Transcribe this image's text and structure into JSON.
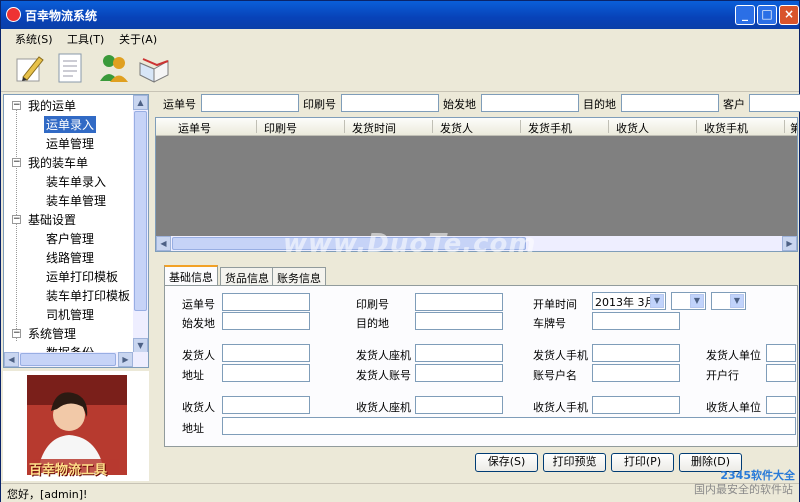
{
  "window": {
    "title": "百幸物流系统",
    "buttons": {
      "minimize": "_",
      "maximize": "□",
      "close": "×"
    }
  },
  "menubar": {
    "items": [
      "系统(S)",
      "工具(T)",
      "关于(A)"
    ]
  },
  "toolbar": {
    "tools": [
      "pencil-edit-icon",
      "document-icon",
      "users-icon",
      "book-icon"
    ]
  },
  "sidebar": {
    "tree": [
      {
        "label": "我的运单",
        "expander": "−"
      },
      {
        "label": "运单录入"
      },
      {
        "label": "运单管理"
      },
      {
        "label": "我的装车单",
        "expander": "−"
      },
      {
        "label": "装车单录入"
      },
      {
        "label": "装车单管理"
      },
      {
        "label": "基础设置",
        "expander": "−"
      },
      {
        "label": "客户管理"
      },
      {
        "label": "线路管理"
      },
      {
        "label": "运单打印模板"
      },
      {
        "label": "装车单打印模板"
      },
      {
        "label": "司机管理"
      },
      {
        "label": "系统管理",
        "expander": "−"
      },
      {
        "label": "数据备份"
      }
    ],
    "selected_index": 1,
    "photo_caption": "百幸物流工具"
  },
  "search": {
    "fields": [
      {
        "label": "运单号",
        "value": ""
      },
      {
        "label": "印刷号",
        "value": ""
      },
      {
        "label": "始发地",
        "value": ""
      },
      {
        "label": "目的地",
        "value": ""
      },
      {
        "label": "客户",
        "value": ""
      }
    ]
  },
  "grid": {
    "columns": [
      "运单号",
      "印刷号",
      "发货时间",
      "发货人",
      "发货手机",
      "收货人",
      "收货手机",
      "第"
    ]
  },
  "tabs": {
    "items": [
      "基础信息",
      "货品信息",
      "账务信息"
    ],
    "active": 0
  },
  "form": {
    "waybill_no": {
      "label": "运单号",
      "value": ""
    },
    "print_no": {
      "label": "印刷号",
      "value": ""
    },
    "open_time": {
      "label": "开单时间",
      "value": "2013年 3月"
    },
    "origin": {
      "label": "始发地",
      "value": ""
    },
    "destination": {
      "label": "目的地",
      "value": ""
    },
    "plate": {
      "label": "车牌号",
      "value": ""
    },
    "shipper": {
      "label": "发货人",
      "value": ""
    },
    "shipper_phone": {
      "label": "发货人座机",
      "value": ""
    },
    "shipper_mobile": {
      "label": "发货人手机",
      "value": ""
    },
    "shipper_unit": {
      "label": "发货人单位",
      "value": ""
    },
    "address1": {
      "label": "地址",
      "value": ""
    },
    "shipper_account": {
      "label": "发货人账号",
      "value": ""
    },
    "account_name": {
      "label": "账号户名",
      "value": ""
    },
    "bank": {
      "label": "开户行",
      "value": ""
    },
    "receiver": {
      "label": "收货人",
      "value": ""
    },
    "receiver_phone": {
      "label": "收货人座机",
      "value": ""
    },
    "receiver_mobile": {
      "label": "收货人手机",
      "value": ""
    },
    "receiver_unit": {
      "label": "收货人单位",
      "value": ""
    },
    "address2": {
      "label": "地址",
      "value": ""
    }
  },
  "actions": {
    "save": "保存(S)",
    "print_preview": "打印预览",
    "print": "打印(P)",
    "delete": "删除(D)"
  },
  "status": {
    "text": "您好，[admin]!"
  },
  "watermarks": {
    "center": "www.DuoTe.com",
    "corner1": "2345软件大全",
    "corner2": "国内最安全的软件站"
  }
}
